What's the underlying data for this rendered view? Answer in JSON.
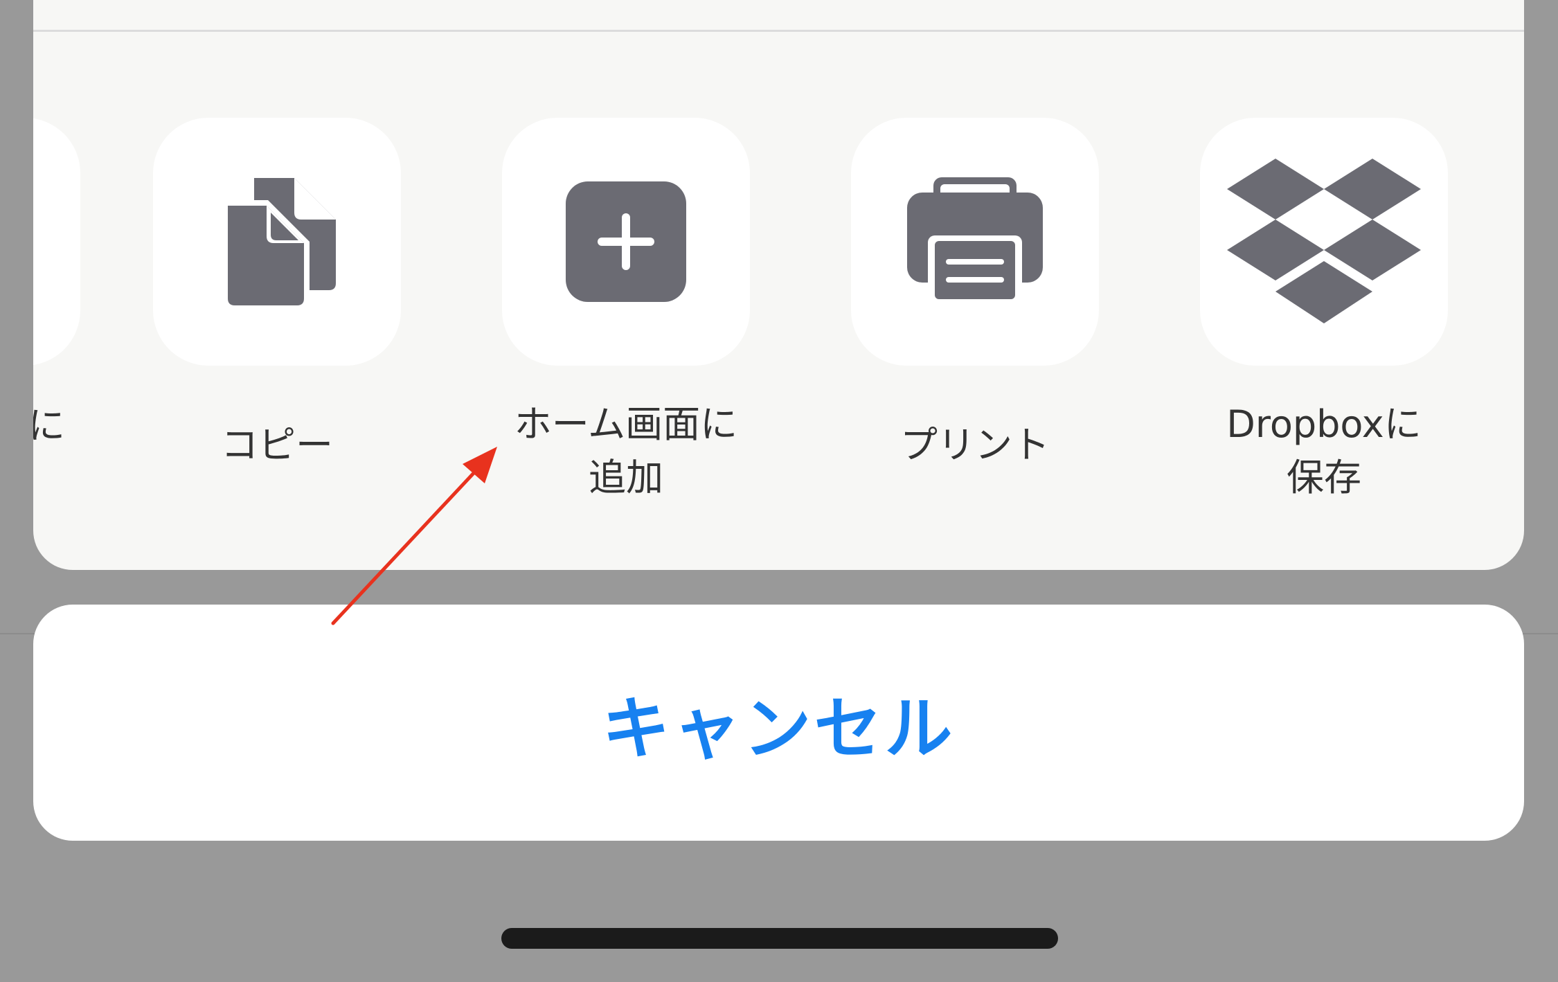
{
  "share_sheet": {
    "partial_label": "に",
    "actions": [
      {
        "key": "copy",
        "label_line1": "コピー",
        "label_line2": "",
        "icon": "copy-documents-icon"
      },
      {
        "key": "add_to_home",
        "label_line1": "ホーム画面に",
        "label_line2": "追加",
        "icon": "add-square-plus-icon"
      },
      {
        "key": "print",
        "label_line1": "プリント",
        "label_line2": "",
        "icon": "printer-icon"
      },
      {
        "key": "dropbox",
        "label_line1": "Dropboxに",
        "label_line2": "保存",
        "icon": "dropbox-icon"
      }
    ]
  },
  "cancel_label": "キャンセル",
  "colors": {
    "backdrop": "#999999",
    "sheet": "#f7f7f5",
    "icon": "#6b6b73",
    "accent": "#1781f0",
    "annotation_arrow": "#e8321e"
  }
}
